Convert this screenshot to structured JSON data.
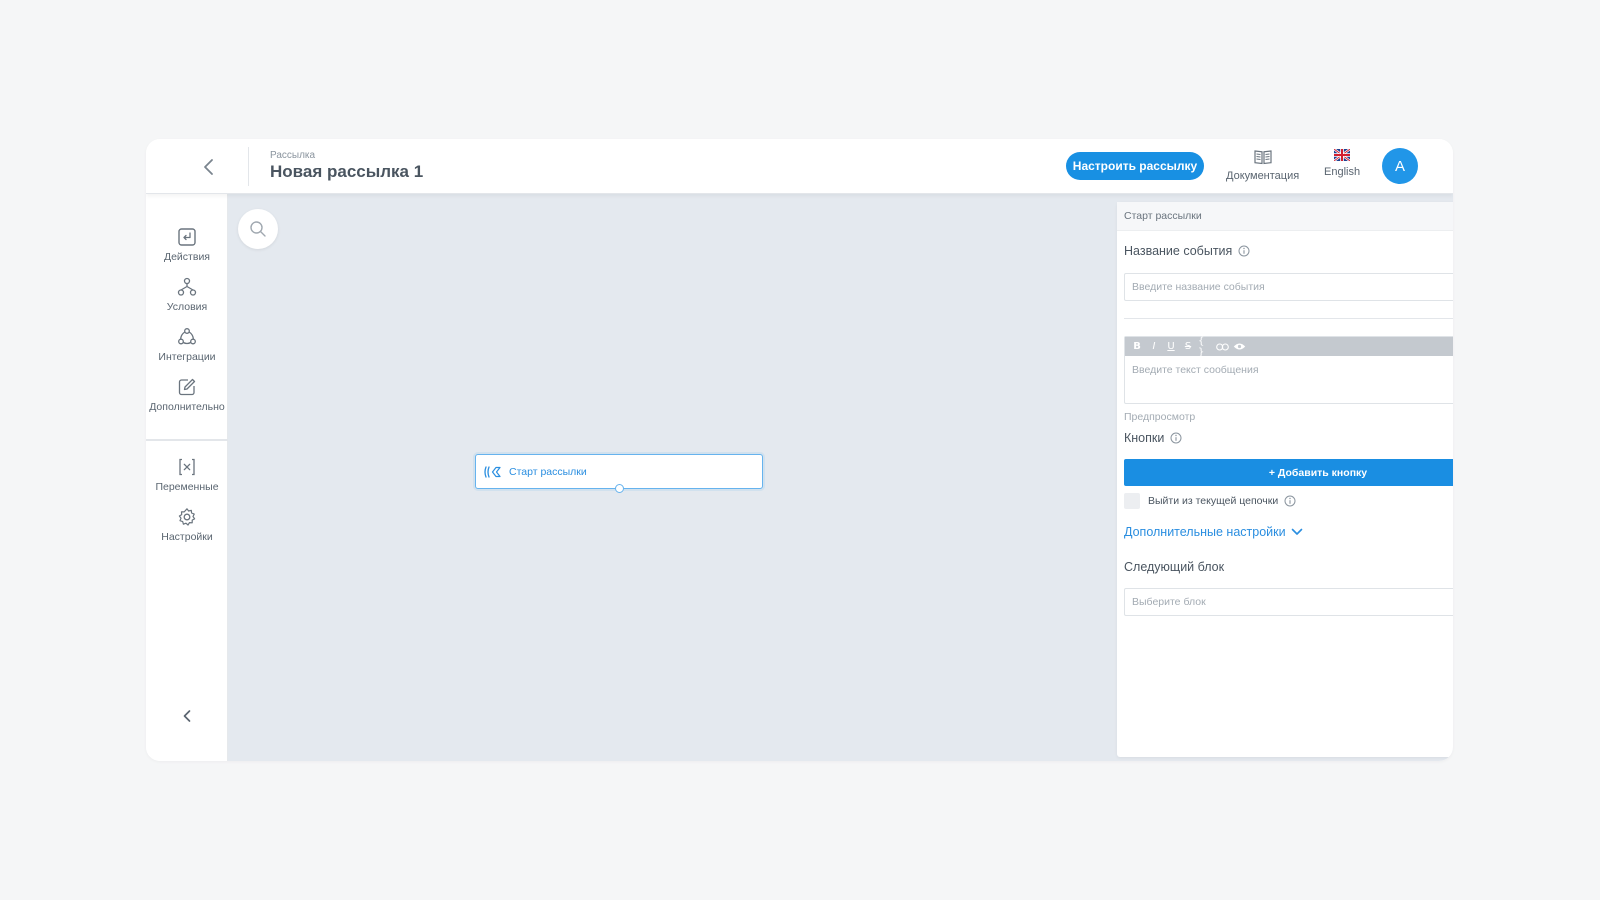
{
  "header": {
    "breadcrumb": "Рассылка",
    "title": "Новая рассылка 1",
    "configure_label": "Настроить рассылку",
    "docs_label": "Документация",
    "language_label": "English",
    "avatar_initial": "A"
  },
  "sidebar": {
    "items": [
      {
        "label": "Действия",
        "icon": "actions-icon"
      },
      {
        "label": "Условия",
        "icon": "conditions-icon"
      },
      {
        "label": "Интеграции",
        "icon": "integrations-icon"
      },
      {
        "label": "Дополнительно",
        "icon": "additional-icon"
      },
      {
        "label": "Переменные",
        "icon": "variables-icon"
      },
      {
        "label": "Настройки",
        "icon": "gear-icon"
      }
    ]
  },
  "canvas": {
    "node_label": "Старт рассылки"
  },
  "panel": {
    "title": "Старт рассылки",
    "event_name_label": "Название события",
    "event_name_placeholder": "Введите название события",
    "message_placeholder": "Введите текст сообщения",
    "toolbar_buttons": [
      "B",
      "I",
      "U",
      "S",
      "{ }",
      "link",
      "eye"
    ],
    "preview_label": "Предпросмотр",
    "buttons_label": "Кнопки",
    "add_button_label": "+ Добавить кнопку",
    "exit_chain_label": "Выйти из текущей цепочки",
    "more_settings_label": "Дополнительные настройки",
    "next_block_label": "Следующий блок",
    "next_block_placeholder": "Выберите блок"
  },
  "colors": {
    "accent": "#1a8ee2",
    "canvas_bg": "#e4e9ef",
    "page_bg": "#f5f6f7"
  }
}
